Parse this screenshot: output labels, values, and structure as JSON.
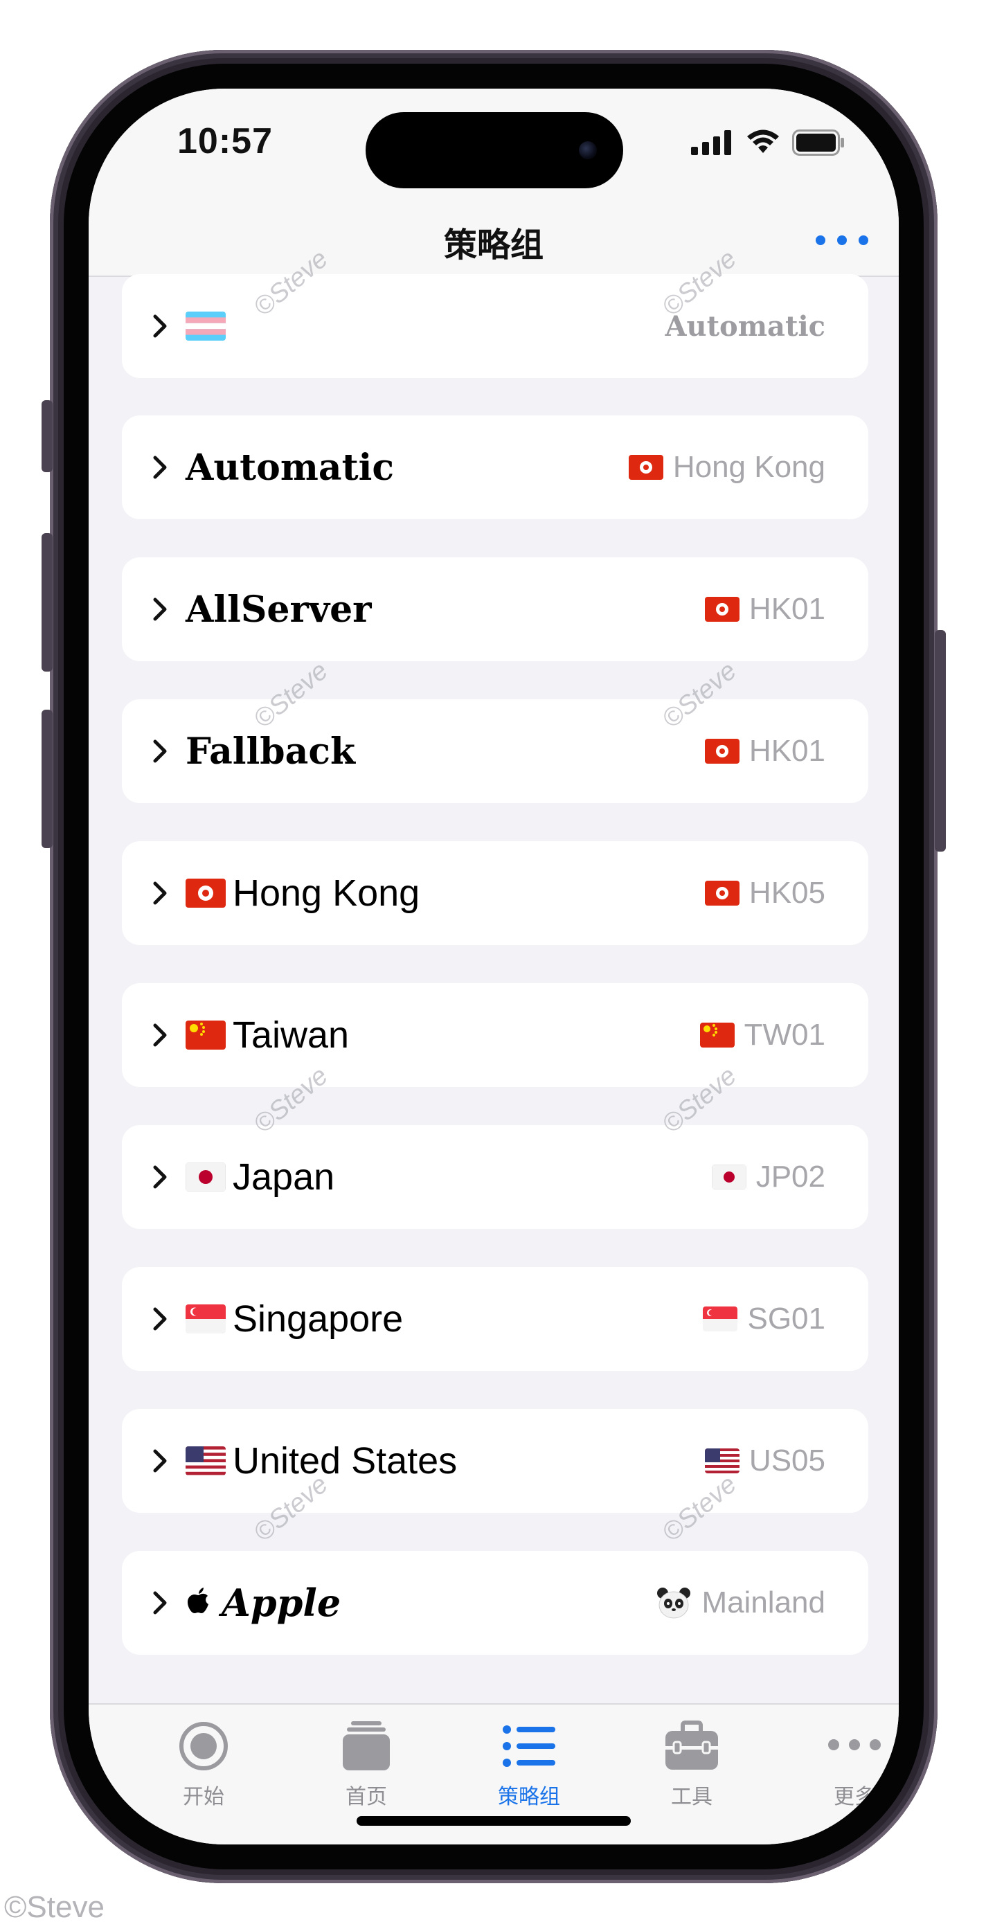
{
  "status_bar": {
    "time": "10:57",
    "signal_icon": "cellular-signal-icon",
    "wifi_icon": "wifi-icon",
    "battery_icon": "battery-full-icon"
  },
  "nav": {
    "title": "策略组",
    "more_icon": "ellipsis-icon",
    "accent_color": "#1a73e8"
  },
  "policy_groups": [
    {
      "title": "",
      "title_flag": "transgender-flag",
      "value": "Automatic",
      "value_flag": ""
    },
    {
      "title": "Automatic",
      "title_flag": "",
      "value": "Hong Kong",
      "value_flag": "hk"
    },
    {
      "title": "AllServer",
      "title_flag": "",
      "value": "HK01",
      "value_flag": "hk"
    },
    {
      "title": "Fallback",
      "title_flag": "",
      "value": "HK01",
      "value_flag": "hk"
    },
    {
      "title": "Hong Kong",
      "title_flag": "hk",
      "value": "HK05",
      "value_flag": "hk"
    },
    {
      "title": "Taiwan",
      "title_flag": "cn",
      "value": "TW01",
      "value_flag": "cn"
    },
    {
      "title": "Japan",
      "title_flag": "jp",
      "value": "JP02",
      "value_flag": "jp"
    },
    {
      "title": "Singapore",
      "title_flag": "sg",
      "value": "SG01",
      "value_flag": "sg"
    },
    {
      "title": "United States",
      "title_flag": "us",
      "value": "US05",
      "value_flag": "us"
    },
    {
      "title": "Apple",
      "title_flag": "apple-logo",
      "value": "Mainland",
      "value_flag": "panda-emoji"
    }
  ],
  "tabs": [
    {
      "label": "开始",
      "icon": "record-circle-icon",
      "active": false
    },
    {
      "label": "首页",
      "icon": "stacked-cards-icon",
      "active": false
    },
    {
      "label": "策略组",
      "icon": "list-bullet-icon",
      "active": true
    },
    {
      "label": "工具",
      "icon": "toolbox-icon",
      "active": false
    },
    {
      "label": "更多",
      "icon": "ellipsis-icon",
      "active": false
    }
  ],
  "watermark": "©Steve",
  "footer_credit": "©Steve"
}
